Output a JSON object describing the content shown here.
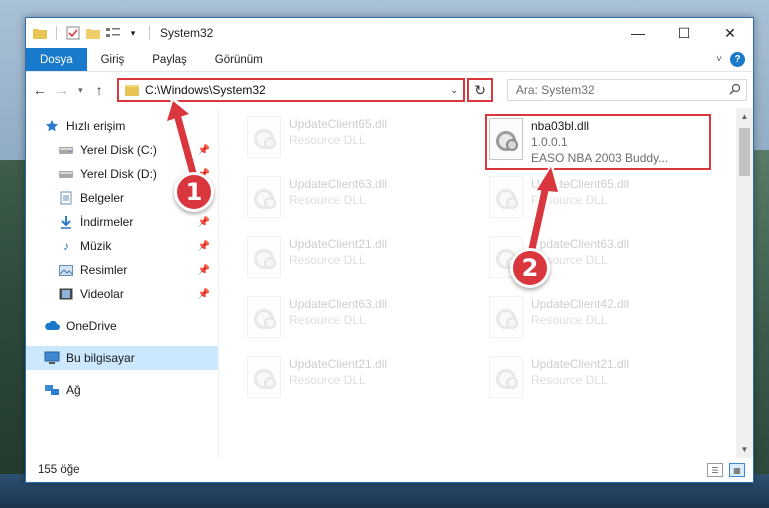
{
  "window": {
    "title": "System32",
    "controls": {
      "minimize": "—",
      "maximize": "☐",
      "close": "✕"
    }
  },
  "ribbon": {
    "tabs": [
      "Dosya",
      "Giriş",
      "Paylaş",
      "Görünüm"
    ],
    "help_label": "?"
  },
  "address": {
    "path": "C:\\Windows\\System32",
    "search_placeholder": "Ara: System32"
  },
  "sidebar": {
    "quick_access": "Hızlı erişim",
    "items": [
      {
        "label": "Yerel Disk (C:)",
        "icon": "drive-icon",
        "pinned": true
      },
      {
        "label": "Yerel Disk (D:)",
        "icon": "drive-icon",
        "pinned": true
      },
      {
        "label": "Belgeler",
        "icon": "documents-icon",
        "pinned": true
      },
      {
        "label": "İndirmeler",
        "icon": "downloads-icon",
        "pinned": true
      },
      {
        "label": "Müzik",
        "icon": "music-icon",
        "pinned": true
      },
      {
        "label": "Resimler",
        "icon": "pictures-icon",
        "pinned": true
      },
      {
        "label": "Videolar",
        "icon": "videos-icon",
        "pinned": true
      }
    ],
    "onedrive": "OneDrive",
    "this_pc": "Bu bilgisayar",
    "network": "Ağ"
  },
  "files": {
    "highlighted": {
      "name": "nba03bl.dll",
      "version": "1.0.0.1",
      "description": "EASO NBA 2003 Buddy..."
    },
    "faded_left": [
      {
        "name": "UpdateClient65.dll",
        "type": "Resource DLL"
      },
      {
        "name": "UpdateClient63.dll",
        "type": "Resource DLL"
      },
      {
        "name": "UpdateClient21.dll",
        "type": "Resource DLL"
      },
      {
        "name": "UpdateClient63.dll",
        "type": "Resource DLL"
      },
      {
        "name": "UpdateClient21.dll",
        "type": "Resource DLL"
      }
    ],
    "faded_right": [
      {
        "name": "UpdateClient65.dll",
        "type": "Resource DLL"
      },
      {
        "name": "UpdateClient63.dll",
        "type": "Resource DLL"
      },
      {
        "name": "UpdateClient42.dll",
        "type": "Resource DLL"
      },
      {
        "name": "UpdateClient21.dll",
        "type": "Resource DLL"
      }
    ]
  },
  "status": {
    "count": "155 öğe"
  },
  "annotations": {
    "badge1": "1",
    "badge2": "2",
    "color": "#d9363e"
  }
}
